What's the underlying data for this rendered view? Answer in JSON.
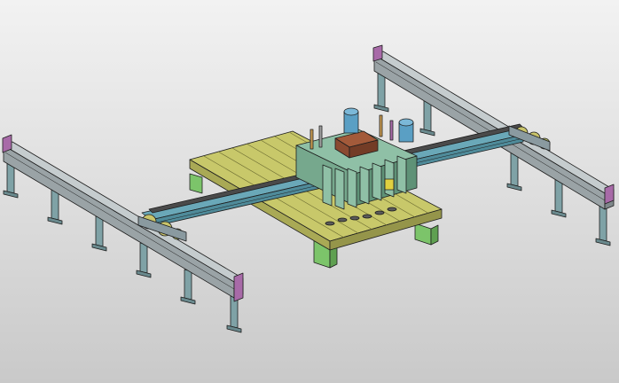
{
  "scene": {
    "description_free": true,
    "colors": {
      "background_top": "#f2f2f2",
      "background_bottom": "#c9c9c9",
      "rail_steel": "#9aa3a6",
      "rail_top": "#c5ccce",
      "column": "#7fa2a6",
      "end_cap": "#a86aa8",
      "platform": "#c8c86a",
      "platform_side": "#a9a955",
      "platform_leg": "#7cc46a",
      "carriage_frame": "#8fc0a6",
      "motor_blue": "#5a9fc4",
      "drive_box": "#8a4a30",
      "beam_cyan": "#6aa8b8",
      "gear_yellow": "#c9c46a",
      "tool_yellow": "#e0d040"
    },
    "icons": {
      "left_rail": "gantry-rail",
      "right_rail": "gantry-rail",
      "platform": "slotted-worktable",
      "carriage": "gantry-carriage",
      "motors": "servo-motor"
    }
  }
}
